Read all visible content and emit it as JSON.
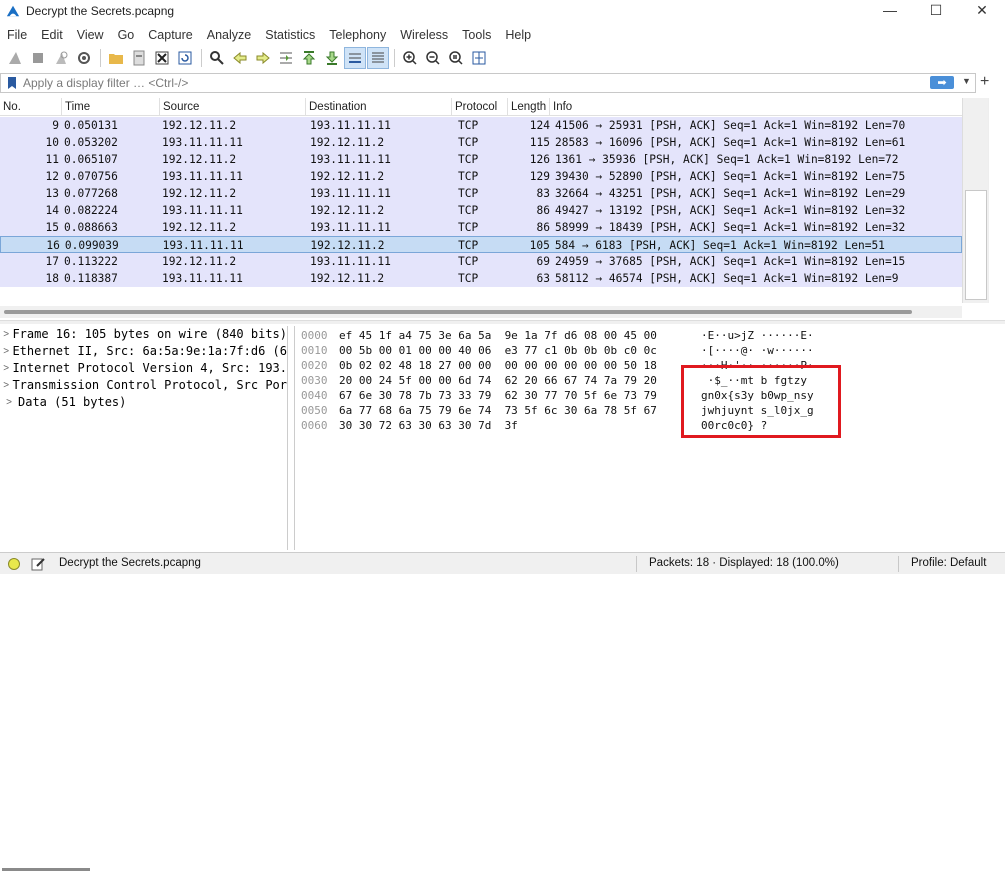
{
  "window": {
    "title": "Decrypt the Secrets.pcapng",
    "minimize": "—",
    "maximize": "☐",
    "close": "✕"
  },
  "menu": [
    "File",
    "Edit",
    "View",
    "Go",
    "Capture",
    "Analyze",
    "Statistics",
    "Telephony",
    "Wireless",
    "Tools",
    "Help"
  ],
  "filter": {
    "placeholder": "Apply a display filter … <Ctrl-/>",
    "apply": "➡",
    "dropdown": "▼",
    "add": "+"
  },
  "columns": [
    "No.",
    "Time",
    "Source",
    "Destination",
    "Protocol",
    "Length",
    "Info"
  ],
  "packets": [
    {
      "no": "9",
      "time": "0.050131",
      "src": "192.12.11.2",
      "dst": "193.11.11.11",
      "proto": "TCP",
      "len": "124",
      "info": "41506 → 25931 [PSH, ACK] Seq=1 Ack=1 Win=8192 Len=70",
      "selected": false
    },
    {
      "no": "10",
      "time": "0.053202",
      "src": "193.11.11.11",
      "dst": "192.12.11.2",
      "proto": "TCP",
      "len": "115",
      "info": "28583 → 16096 [PSH, ACK] Seq=1 Ack=1 Win=8192 Len=61",
      "selected": false
    },
    {
      "no": "11",
      "time": "0.065107",
      "src": "192.12.11.2",
      "dst": "193.11.11.11",
      "proto": "TCP",
      "len": "126",
      "info": "1361 → 35936 [PSH, ACK] Seq=1 Ack=1 Win=8192 Len=72",
      "selected": false
    },
    {
      "no": "12",
      "time": "0.070756",
      "src": "193.11.11.11",
      "dst": "192.12.11.2",
      "proto": "TCP",
      "len": "129",
      "info": "39430 → 52890 [PSH, ACK] Seq=1 Ack=1 Win=8192 Len=75",
      "selected": false
    },
    {
      "no": "13",
      "time": "0.077268",
      "src": "192.12.11.2",
      "dst": "193.11.11.11",
      "proto": "TCP",
      "len": "83",
      "info": "32664 → 43251 [PSH, ACK] Seq=1 Ack=1 Win=8192 Len=29",
      "selected": false
    },
    {
      "no": "14",
      "time": "0.082224",
      "src": "193.11.11.11",
      "dst": "192.12.11.2",
      "proto": "TCP",
      "len": "86",
      "info": "49427 → 13192 [PSH, ACK] Seq=1 Ack=1 Win=8192 Len=32",
      "selected": false
    },
    {
      "no": "15",
      "time": "0.088663",
      "src": "192.12.11.2",
      "dst": "193.11.11.11",
      "proto": "TCP",
      "len": "86",
      "info": "58999 → 18439 [PSH, ACK] Seq=1 Ack=1 Win=8192 Len=32",
      "selected": false
    },
    {
      "no": "16",
      "time": "0.099039",
      "src": "193.11.11.11",
      "dst": "192.12.11.2",
      "proto": "TCP",
      "len": "105",
      "info": "584 → 6183 [PSH, ACK] Seq=1 Ack=1 Win=8192 Len=51",
      "selected": true
    },
    {
      "no": "17",
      "time": "0.113222",
      "src": "192.12.11.2",
      "dst": "193.11.11.11",
      "proto": "TCP",
      "len": "69",
      "info": "24959 → 37685 [PSH, ACK] Seq=1 Ack=1 Win=8192 Len=15",
      "selected": false
    },
    {
      "no": "18",
      "time": "0.118387",
      "src": "193.11.11.11",
      "dst": "192.12.11.2",
      "proto": "TCP",
      "len": "63",
      "info": "58112 → 46574 [PSH, ACK] Seq=1 Ack=1 Win=8192 Len=9",
      "selected": false
    }
  ],
  "details": [
    "Frame 16: 105 bytes on wire (840 bits)",
    "Ethernet II, Src: 6a:5a:9e:1a:7f:d6 (6",
    "Internet Protocol Version 4, Src: 193.",
    "Transmission Control Protocol, Src Por",
    "Data (51 bytes)"
  ],
  "bytes": [
    {
      "offset": "0000",
      "hex": "ef 45 1f a4 75 3e 6a 5a  9e 1a 7f d6 08 00 45 00",
      "ascii": "·E··u>jZ ······E·"
    },
    {
      "offset": "0010",
      "hex": "00 5b 00 01 00 00 40 06  e3 77 c1 0b 0b 0b c0 0c",
      "ascii": "·[····@· ·w······"
    },
    {
      "offset": "0020",
      "hex": "0b 02 02 48 18 27 00 00  00 00 00 00 00 00 50 18",
      "ascii": "···H·'·· ······P·"
    },
    {
      "offset": "0030",
      "hex": "20 00 24 5f 00 00 6d 74  62 20 66 67 74 7a 79 20",
      "ascii": " ·$_··mt b fgtzy "
    },
    {
      "offset": "0040",
      "hex": "67 6e 30 78 7b 73 33 79  62 30 77 70 5f 6e 73 79",
      "ascii": "gn0x{s3y b0wp_nsy"
    },
    {
      "offset": "0050",
      "hex": "6a 77 68 6a 75 79 6e 74  73 5f 6c 30 6a 78 5f 67",
      "ascii": "jwhjuynt s_l0jx_g"
    },
    {
      "offset": "0060",
      "hex": "30 30 72 63 30 63 30 7d  3f",
      "ascii": "00rc0c0} ?"
    }
  ],
  "status": {
    "file": "Decrypt the Secrets.pcapng",
    "packets": "Packets: 18 · Displayed: 18 (100.0%)",
    "profile": "Profile: Default"
  },
  "colors": {
    "row_bg": "#e4e4fb",
    "selected_bg": "#c6dcf4",
    "highlight": "#e0191f"
  }
}
